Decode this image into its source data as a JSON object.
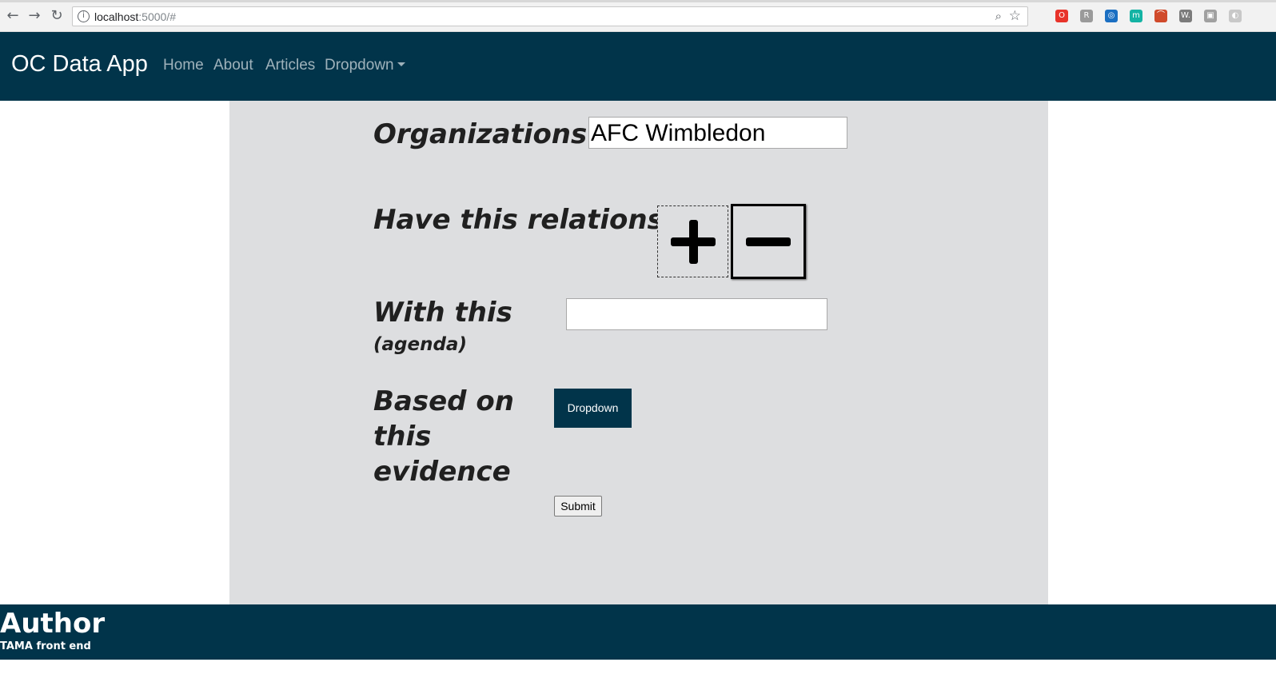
{
  "browser": {
    "url_host": "localhost",
    "url_rest": ":5000/#",
    "back_icon": "arrow-left",
    "forward_icon": "arrow-right",
    "reload_icon": "reload",
    "info_icon": "i",
    "zoom_icon": "magnifier",
    "star_icon": "star",
    "extensions": [
      {
        "name": "opera-ext-icon",
        "color": "#e8332a",
        "glyph": "O"
      },
      {
        "name": "pocket-ext-icon",
        "color": "#9a9a9a",
        "glyph": "R"
      },
      {
        "name": "compass-ext-icon",
        "color": "#1b6fc2",
        "glyph": "◎"
      },
      {
        "name": "m-ext-icon",
        "color": "#14b3a4",
        "glyph": "m"
      },
      {
        "name": "rainbow-ext-icon",
        "color": "#d04a2b",
        "glyph": "⌒"
      },
      {
        "name": "w-ext-icon",
        "color": "#7b7b7b",
        "glyph": "W."
      },
      {
        "name": "grey-ext-icon",
        "color": "#a0a0a0",
        "glyph": "▣"
      },
      {
        "name": "faded-ext-icon",
        "color": "#c8c8c8",
        "glyph": "◐"
      }
    ]
  },
  "navbar": {
    "brand": "OC Data App",
    "links": [
      "Home",
      "About",
      "Articles",
      "Dropdown"
    ],
    "bg_color": "#01344a"
  },
  "form": {
    "organizations_label": "Organizations",
    "organizations_value": "AFC Wimbledon",
    "relationship_label": "Have this relationship",
    "plus_icon": "plus",
    "minus_icon": "minus",
    "with_this_label": "With this",
    "with_this_sub": "(agenda)",
    "agenda_value": "",
    "evidence_label": "Based on this evidence",
    "dropdown_label": "Dropdown",
    "submit_label": "Submit"
  },
  "footer": {
    "title": "Author",
    "subtitle": "TAMA front end"
  }
}
